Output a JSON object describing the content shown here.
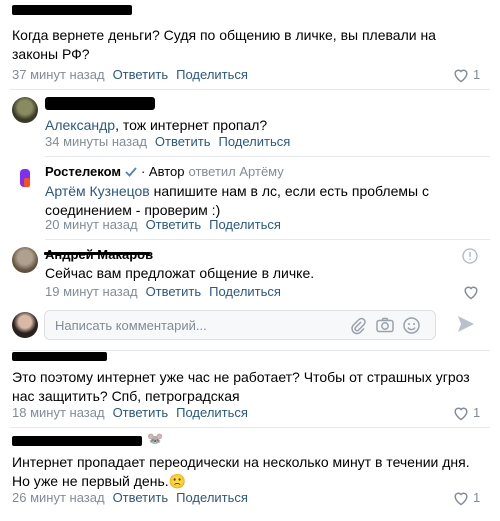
{
  "comments": [
    {
      "text": "Когда вернете деньги? Судя по общению в личке, вы плевали на законы РФ?",
      "time": "37 минут назад",
      "reply": "Ответить",
      "share": "Поделиться",
      "likes": "1"
    },
    {
      "mention": "Александр",
      "text": ", тож интернет пропал?",
      "time": "34 минуты назад",
      "reply": "Ответить",
      "share": "Поделиться"
    },
    {
      "author": "Ростелеком",
      "author_badge": "· Автор",
      "replied_to": "ответил Артёму",
      "mention": "Артём Кузнецов",
      "text": " напишите нам в лс, если есть проблемы с соединением - проверим :)",
      "time": "20 минут назад",
      "reply": "Ответить",
      "share": "Поделиться"
    },
    {
      "author": "Андрей Макаров",
      "text": "Сейчас вам предложат общение в личке.",
      "time": "19 минут назад",
      "reply": "Ответить",
      "share": "Поделиться"
    },
    {
      "text": "Это поэтому интернет уже час не работает? Чтобы от страшных угроз нас защитить? Спб, петроградская",
      "time": "18 минут назад",
      "reply": "Ответить",
      "share": "Поделиться",
      "likes": "1"
    },
    {
      "text": "Интернет пропадает переодически на несколько минут в течении дня.",
      "text2": "Но уже не первый день.",
      "emoji": "🙁",
      "time": "26 минут назад",
      "reply": "Ответить",
      "share": "Поделиться",
      "likes": "1"
    }
  ],
  "compose": {
    "placeholder": "Написать комментарий..."
  },
  "colors": {
    "link": "#2a5885",
    "meta": "#818c99",
    "verified": "#5181b8"
  }
}
